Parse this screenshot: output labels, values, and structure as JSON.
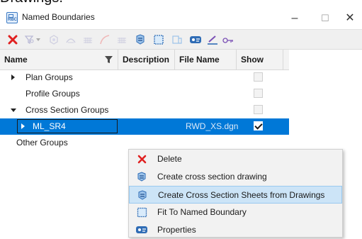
{
  "background_header": "Drawings.",
  "window": {
    "app_icon_text": "RBC",
    "title": "Named Boundaries",
    "minimize_glyph": "–",
    "maximize_glyph": "☐",
    "close_glyph": "✕"
  },
  "toolbar": {
    "buttons": [
      {
        "name": "delete-icon",
        "color": "#e02020"
      },
      {
        "name": "filter-icon"
      },
      {
        "name": "dropdown-arrow-icon"
      },
      {
        "name": "boundary-icon"
      },
      {
        "name": "arc-icon"
      },
      {
        "name": "grid-icon"
      },
      {
        "name": "curve-icon"
      },
      {
        "name": "grid-icon"
      },
      {
        "name": "cross-section-sheet-icon"
      },
      {
        "name": "fit-boundary-icon"
      },
      {
        "name": "drawing-model-icon"
      },
      {
        "name": "properties-icon"
      },
      {
        "name": "pen-edit-icon"
      },
      {
        "name": "key-settings-icon"
      }
    ]
  },
  "grid": {
    "columns": {
      "name": "Name",
      "description": "Description",
      "file_name": "File Name",
      "show": "Show"
    },
    "rows": [
      {
        "label": "Plan Groups",
        "expander": "collapsed",
        "show": false
      },
      {
        "label": "Profile Groups",
        "expander": "none",
        "show": false
      },
      {
        "label": "Cross Section Groups",
        "expander": "expanded",
        "show": false
      },
      {
        "label": "ML_SR4",
        "expander": "collapsed",
        "file_name": "RWD_XS.dgn",
        "show": true,
        "selected": true
      },
      {
        "label": "Other Groups",
        "expander": "none",
        "show": false
      }
    ]
  },
  "context_menu": {
    "items": [
      {
        "label": "Delete",
        "icon": "delete-icon"
      },
      {
        "label": "Create cross section drawing",
        "icon": "cross-section-icon"
      },
      {
        "label": "Create Cross Section Sheets from Drawings",
        "icon": "cross-section-sheet-icon",
        "highlighted": true
      },
      {
        "label": "Fit To Named Boundary",
        "icon": "fit-boundary-icon"
      },
      {
        "label": "Properties",
        "icon": "properties-icon"
      }
    ]
  },
  "colors": {
    "selection": "#0078d7",
    "menu_highlight": "#cce4f7",
    "delete_red": "#e02020",
    "icon_blue": "#2f6cb5"
  }
}
